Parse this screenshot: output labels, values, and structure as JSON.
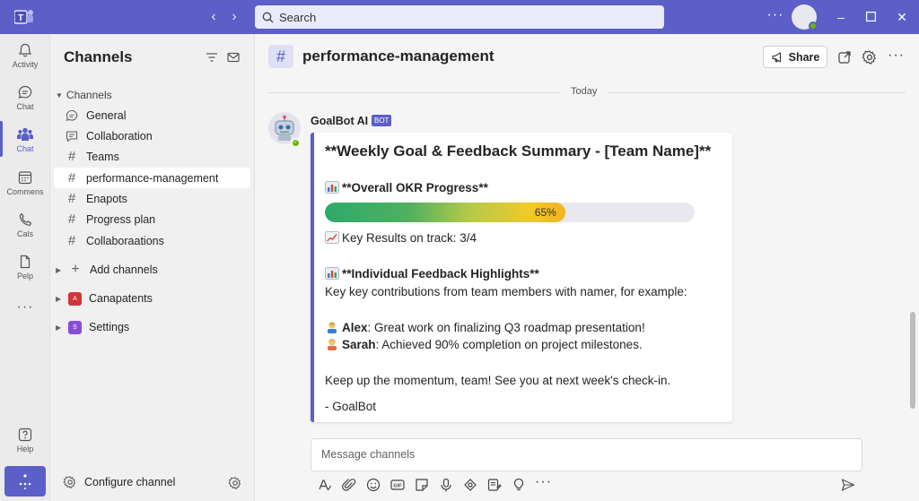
{
  "titlebar": {
    "search_label": "Search",
    "more": "···"
  },
  "rail": [
    {
      "label": "Activity"
    },
    {
      "label": "Chat"
    },
    {
      "label": "Chat"
    },
    {
      "label": "Commens"
    },
    {
      "label": "Cals"
    },
    {
      "label": "Pelp"
    },
    {
      "label": "Help"
    }
  ],
  "pane": {
    "title": "Channels",
    "section": "Channels",
    "channels": [
      {
        "label": "General",
        "icon": "chat-bubble-icon"
      },
      {
        "label": "Collaboration",
        "icon": "chat-box-icon"
      },
      {
        "label": "Teams",
        "icon": "hash-icon"
      },
      {
        "label": "performance-management",
        "icon": "hash-icon",
        "active": true
      },
      {
        "label": "Enapots",
        "icon": "hash-icon"
      },
      {
        "label": "Progress plan",
        "icon": "hash-icon"
      },
      {
        "label": "Collaboraations",
        "icon": "hash-icon"
      }
    ],
    "add_channels": "Add channels",
    "groups": [
      {
        "label": "Canapatents",
        "badge": "A",
        "color": "#d13438"
      },
      {
        "label": "Settings",
        "badge": "S",
        "color": "#8a4cd6"
      }
    ],
    "configure": "Configure channel"
  },
  "main": {
    "channel_title": "performance-management",
    "share_label": "Share",
    "date_divider": "Today",
    "sender": "GoalBot AI",
    "bot_tag": "BOT",
    "card": {
      "title": "**Weekly Goal & Feedback Summary - [Team Name]**",
      "okr_heading": "**Overall OKR Progress**",
      "progress_percent": 65,
      "progress_label": "65%",
      "key_results": "Key Results on track: 3/4",
      "feedback_heading": "**Individual Feedback Highlights**",
      "feedback_intro": "Key key contributions from team members with namer, for example:",
      "entries": [
        {
          "name": "Alex",
          "text": ": Great work on finalizing Q3 roadmap presentation!"
        },
        {
          "name": "Sarah",
          "text": ": Achieved 90% completion on project milestones."
        }
      ],
      "closing": "Keep up the momentum, team! See you at next week's check-in.",
      "signature": "- GoalBot"
    },
    "composer_placeholder": "Message channels"
  }
}
